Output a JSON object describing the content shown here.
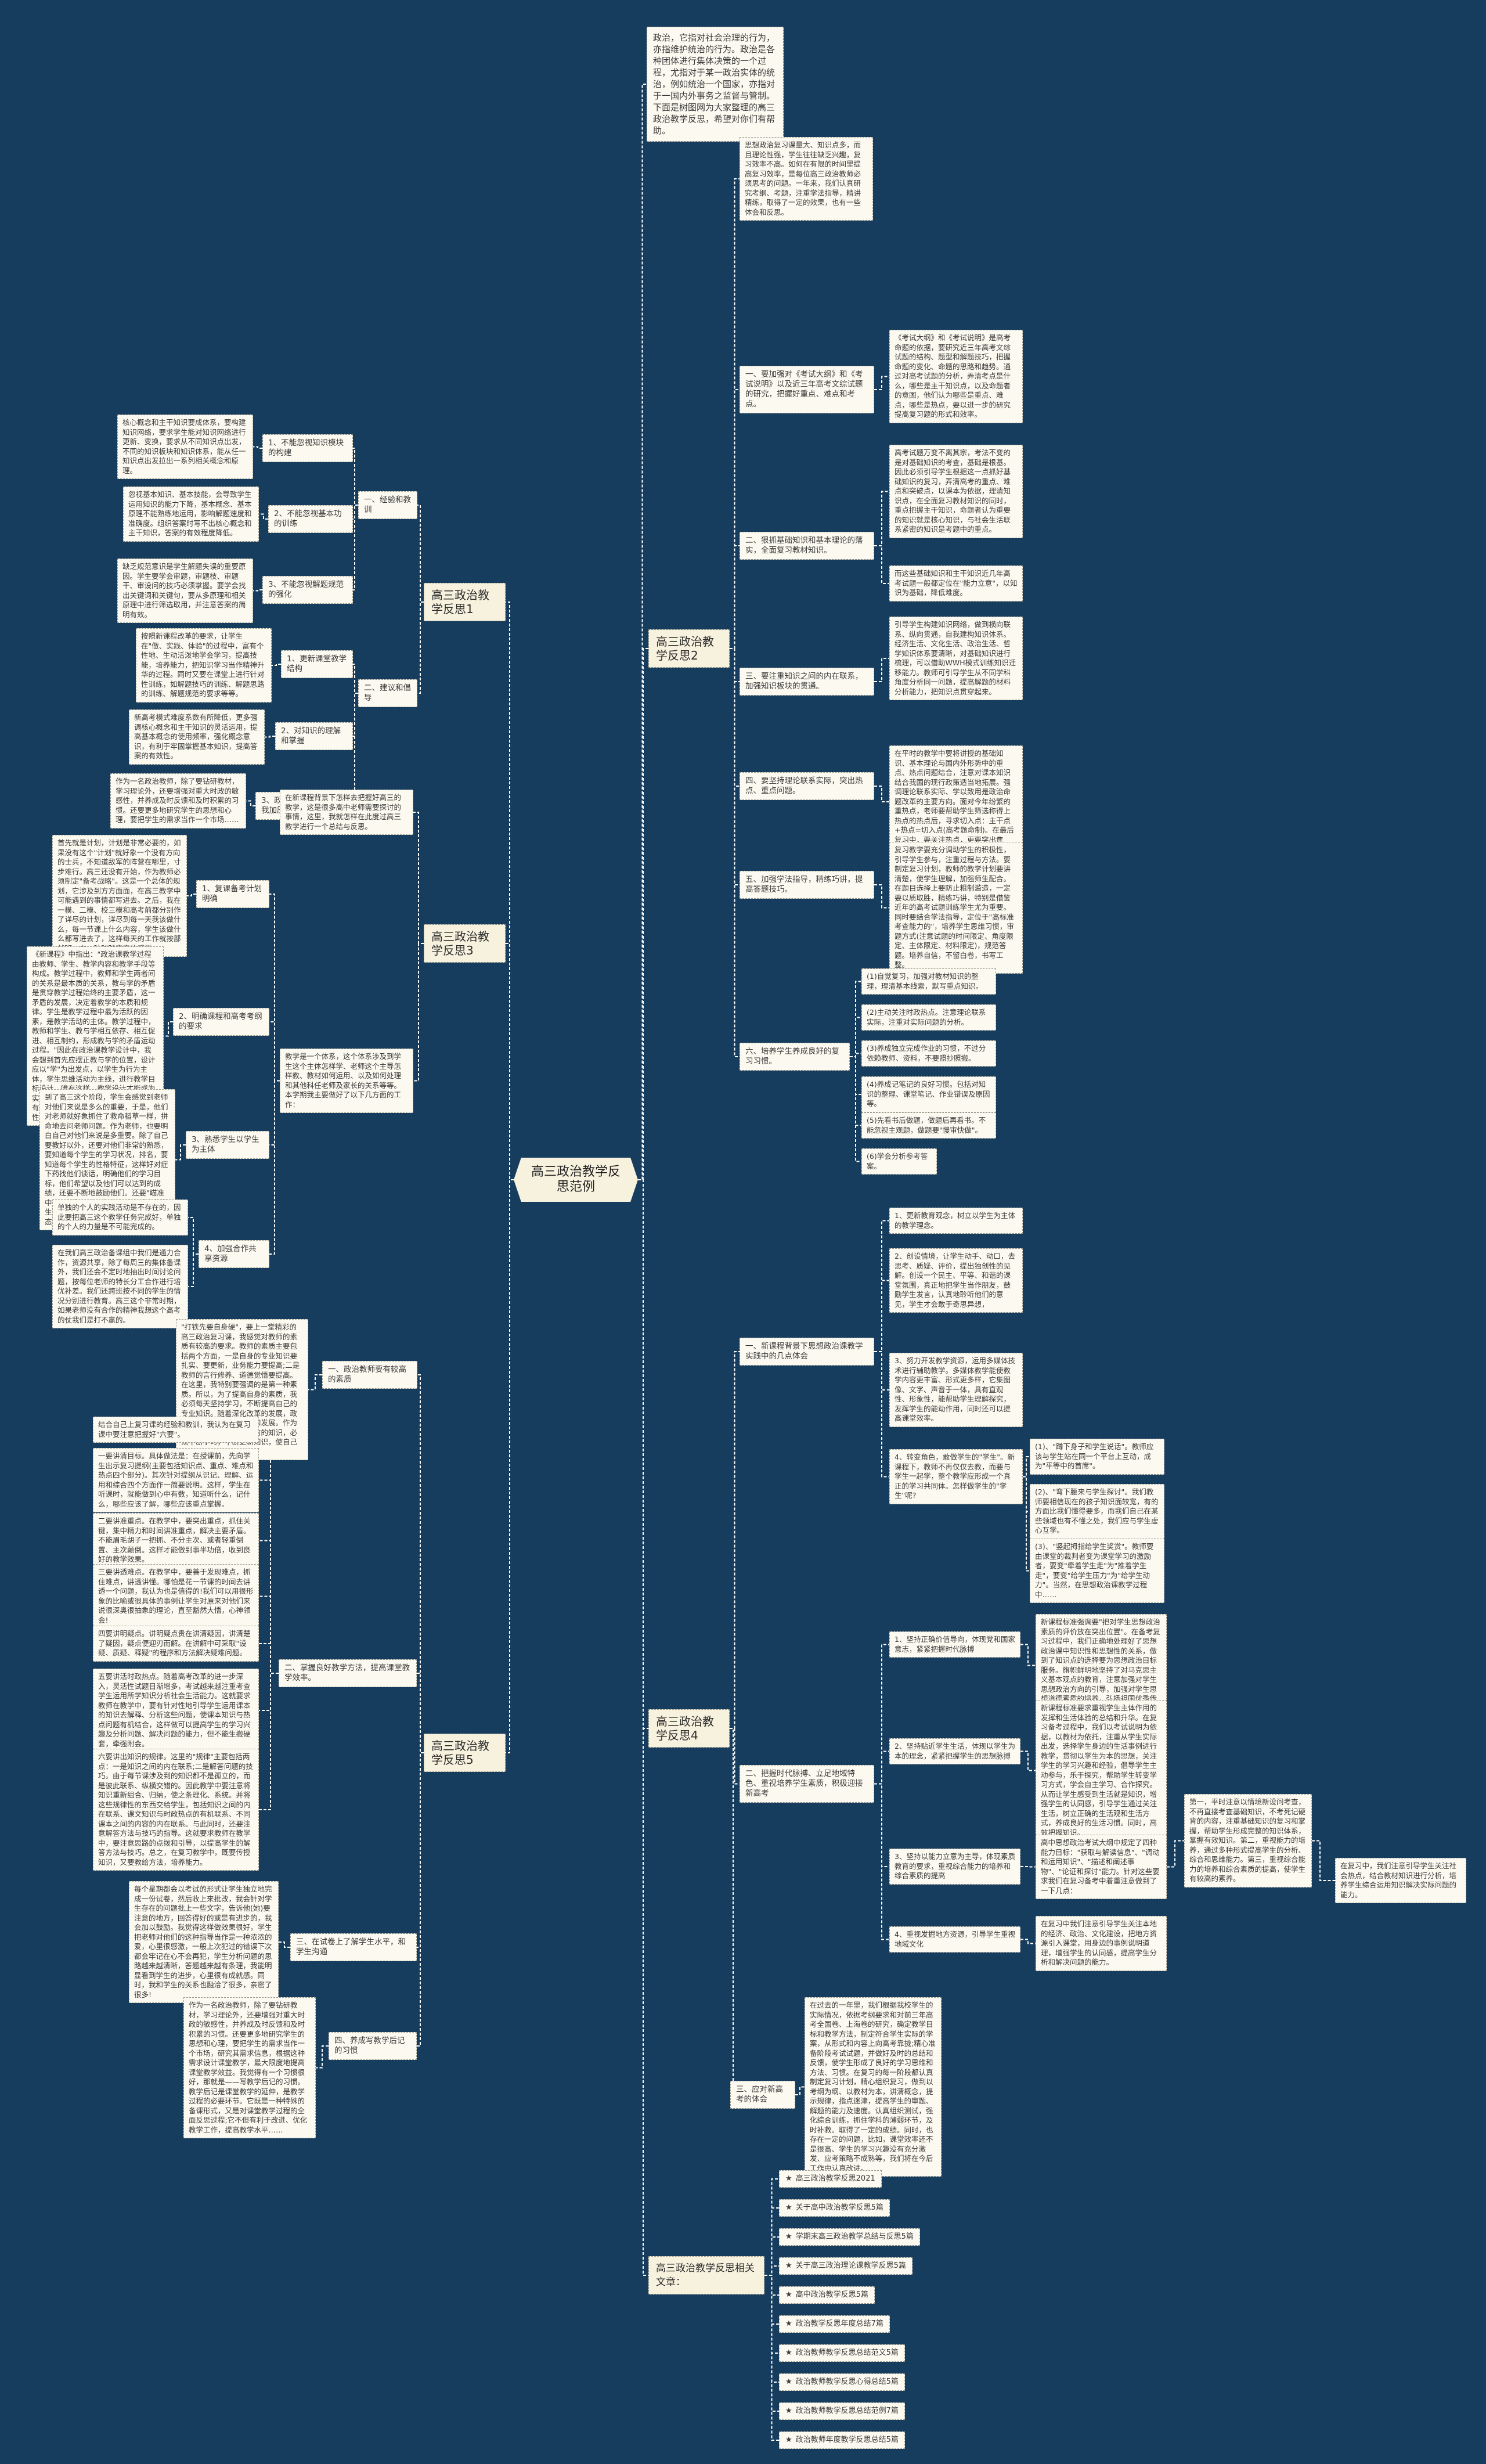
{
  "colors": {
    "background": "#173d5e",
    "node": "#fcfaf0",
    "main_node": "#f7f2de",
    "connector": "#ffffff"
  },
  "root": "高三政治教学反思范例",
  "intro": "政治，它指对社会治理的行为，亦指维护统治的行为。政治是各种团体进行集体决策的一个过程，尤指对于某一政治实体的统治，例如统治一个国家，亦指对于一国内外事务之监督与管制。下面是树图网为大家整理的高三政治教学反思，希望对你们有帮助。",
  "r1": {
    "title": "高三政治教学反思1",
    "a": "一、经验和教训",
    "a1": "1、不能忽视知识模块的构建",
    "a1t": "核心概念和主干知识要成体系，要构建知识网络，要求学生能对知识网络进行更新、变换，要求从不同知识点出发，不同的知识板块和知识体系，能从任一知识点出发拉出一系列相关概念和原理。",
    "a2": "2、不能忽视基本功的训练",
    "a2t": "忽视基本知识、基本技能，会导致学生运用知识的能力下降，基本概念、基本原理不能熟练地运用，影响解题速度和准确度。组织答案时写不出核心概念和主干知识，答案的有效程度降低。",
    "a3": "3、不能忽视解题规范的强化",
    "a3t": "缺乏规范意识是学生解题失误的重要原因。学生要学会审题，审题枝、审题干、审设问的技巧必须掌握。要学会找出关键词和关键句，要从多原理和相关原理中进行筛选取用，并注意答案的简明有效。",
    "b": "二、建议和倡导",
    "b1": "1、更新课堂教学结构",
    "b1t": "按照新课程改革的要求，让学生在\"做、实践、体验\"的过程中，富有个性地、生动活泼地学会学习，提高技能，培养能力，把知识学习当作精神升华的过程。同时又要在课堂上进行针对性训练，如解题技巧的训练、解题思路的训练、解题规范的要求等等。",
    "b2": "2、对知识的理解和掌握",
    "b2t": "新高考模式难度系数有所降低，更多强调核心概念和主干知识的灵活运用，提高基本概念的使用频率，强化概念意识，有利于牢固掌握基本知识，提高答案的有效性。",
    "b3": "3、政治教师要不断地自我加压",
    "b3t": "作为一名政治教师，除了要钻研教材，学习理论外，还要增强对重大时政的敏感性，并养成及时反馈和及时积累的习惯。还要更多地研究学生的思想和心理，要把学生的需求当作一个市场……"
  },
  "r2": {
    "title": "高三政治教学反思2",
    "intro": "思想政治复习课量大、知识点多，而且理论性强，学生往往缺乏兴趣，复习效率不高。如何在有限的时间里提高复习效率，是每位高三政治教师必须思考的问题。一年来，我们认真研究考纲、考题，注重学法指导，精讲精练，取得了一定的效果，也有一些体会和反思。",
    "s1": "一、要加强对《考试大纲》和《考试说明》以及近三年高考文综试题的研究，把握好重点、难点和考点。",
    "s1t": "《考试大纲》和《考试说明》是高考命题的依据，要研究近三年高考文综试题的结构、题型和解题技巧，把握命题的变化、命题的思路和趋势。通过对高考试题的分析，弄清考点是什么，哪些是主干知识点，以及命题者的意图，他们认为哪些是重点、难点，哪些是热点，要以进一步的研究提高复习题的形式和效率。",
    "s2": "二、狠抓基础知识和基本理论的落实，全面复习教材知识。",
    "s2t1": "高考试题万变不离其宗，考法不变的是对基础知识的考查，基础是根基。因此必须引导学生根据这一点抓好基础知识的复习，弄清高考的重点、难点和突破点，以课本为依据，理清知识点，在全面复习教材知识的同时，重点把握主干知识，命题者认为重要的知识就是核心知识，与社会生活联系紧密的知识是考题中的重点。",
    "s2t2": "而这些基础知识和主干知识近几年高考试题一般都定位在\"能力立意\"，以知识为基础，降低难度。",
    "s3": "三、要注重知识之间的内在联系，加强知识板块的贯通。",
    "s3t": "引导学生构建知识网络，做到横向联系、纵向贯通，自我建构知识体系。经济生活、文化生活、政治生活、哲学知识体系要清晰，对基础知识进行梳理，可以借助WWH模式训练知识迁移能力。教师可引导学生从不同学科角度分析同一问题，提高解题的材料分析能力，把知识点贯穿起来。",
    "s4": "四、要坚持理论联系实际，突出热点、重点问题。",
    "s4t": "在平时的教学中要将讲授的基础知识、基本理论与国内外形势中的重点、热点问题结合，注意对课本知识结合我国的现行政策适当地拓展。强调理论联系实际、学以致用是政治命题改革的主要方向。面对今年纷繁的重热点，老师要帮助学生筛选称得上热点的热点后，寻求切入点：主干点+热点=切入点(高考题命制)。在最后复习中，要关注热点，更要突出焦点。",
    "s5": "五、加强学法指导，精练巧讲，提高答题技巧。",
    "s5t": "复习教学要充分调动学生的积极性，引导学生参与，注重过程与方法。要制定复习计划，教师的教学计划要讲清楚，使学生理解，加强师生配合。在题目选择上要防止粗制滥造，一定要以质取胜，精练巧讲，特别是借鉴近年的高考试题训练学生尤为重要。同时要结合学法指导，定位于\"高标准考查能力的\"，培养学生思维习惯，审题方式(注意试题的时间限定、角度限定、主体限定、材料限定)，规范答题。培养自信，不留白卷，书写工整。",
    "s6": "六、培养学生养成良好的复习习惯。",
    "s6_items": [
      "(1)自觉复习，加强对教材知识的整理，理清基本线索，默写重点知识。",
      "(2)主动关注时政热点。注意理论联系实际，注重对实际问题的分析。",
      "(3)养成独立完成作业的习惯，不过分依赖教师、资料，不要照抄照搬。",
      "(4)养成记笔记的良好习惯。包括对知识的整理、课堂笔记、作业错误及原因等。",
      "(5)先看书后做题，做题后再看书。不能忽视主观题，做题要\"慢审快做\"。",
      "(6)学会分析参考答案。"
    ]
  },
  "r3": {
    "title": "高三政治教学反思3",
    "intro": "在新课程背景下怎样去把握好高三的教学，这是很多高中老师需要探讨的事情，这里，我就怎样在此度过高三教学进行一个总结与反思。",
    "system": "教学是一个体系，这个体系涉及到学生这个主体怎样学、老师这个主导怎样教、教材如何运用、以及如何处理和其他科任老师及家长的关系等等。本学期我主要做好了以下几方面的工作：",
    "p1": "1、复课备考计划明确",
    "p1t": "首先就是计划，计划是非常必要的，如果没有这个\"计划\"就好象一个没有方向的士兵，不知道敌军的阵营在哪里，寸步难行。高三还没有开始，作为教师必须制定\"备考战略\"。这是一个总体的规划，它涉及到方方面面，在高三教学中可能遇到的事情都写进去。之后，我在一模、二模、校三模和高考前都分别作了详尽的计划，详尽到每一天我该做什么，每一节课上什么内容，学生该做什么都写进去了，这样每天的工作就按部就班，有一种踏踏实实的感觉。",
    "p2": "2、明确课程和高考考纲的要求",
    "p2t": "《新课程》中指出：\"政治课教学过程由教师、学生、教学内容和教学手段等构成。教学过程中，教师和学生两者间的关系是最本质的关系，教与学的矛盾是贯穿教学过程始终的主要矛盾，这一矛盾的发展，决定着教学的本质和规律。学生是教学过程中最为活跃的因素，是教学活动的主体。教学过程中，教师和学生、教与学相互依存、相互促进、相互制约，形成教与学的矛盾运动过程。\"因此在政治课教学设计中，我会想到首先应摆正教与学的位置，设计应以\"学\"为出发点，以学生为行为主体，学生思维活动为主线，进行教学目标设计。唯有这样，教学设计才能成为实施教学计划的过程的起点。同时，只有研究高考说明，高考复习才有针对性、实效性。",
    "p3": "3、熟悉学生以学生为主体",
    "p3t": "到了高三这个阶段，学生会感觉到老师对他们来说是多么的重要，于是，他们对老师就好象抓住了救命稻草一样，拼命地去问老师问题。作为老师，也要明白自己对他们来说是多重要。除了自己要教好以外，还要对他们非常的熟悉，要知道每个学生的学习状况，排名，要知道每个学生的性格特征，这样好对症下药找他们谈话，明确他们的学习目标，他们希望以及他们可以达到的成绩，还要不断地鼓励他们。还要\"瞄准中间，兼顾两头\"\"每次考试之后这些学生都一一找来谈话了，调节他们的心态。",
    "p4": "4、加强合作共享资源",
    "p4t1": "单独的个人的实践活动是不存在的，因此要把高三这个教学任务完成好，单独的个人的力量是不可能完成的。",
    "p4t2": "在我们高三政治备课组中我们是通力合作，资源共享，除了每周三的集体备课外，我们还会不定时地抽出时间讨论问题，按每位老师的特长分工合作进行培优补差。我们还跨班按不同的学生的情况分别进行教育。高三这个非常时期，如果老师没有合作的精神我想这个高考的仗我们是打不赢的。"
  },
  "r4": {
    "title": "高三政治教学反思4",
    "s1": "一、新课程背景下思想政治课教学实践中的几点体会",
    "s1_1": "1、更新教育观念，树立以学生为主体的教学理念。",
    "s1_2": "2、创设情境，让学生动手、动口，去思考、质疑、评价，提出独创性的见解。创设一个民主、平等、和谐的课堂氛围，真正地把学生当作朋友，鼓励学生发言，认真地聆听他们的意见，学生才会敢于奇思异想，",
    "s1_3": "3、努力开发教学资源，运用多媒体技术进行辅助教学。多媒体教学能使教学内容更丰富、形式更多样，它集图像、文字、声音于一体，具有直观性、形象性，能帮助学生理解探究，发挥学生的能动作用，同时还可以提高课堂效率。",
    "s1_4": "4、转变角色，敢做学生的\"学生\"。新课程下，教师不再仅仅去教，而要与学生一起学，整个教学应形成一个真正的学习共同体。怎样做学生的\"学生\"呢?",
    "s1_4_items": [
      "(1)、\"蹲下身子和学生说话\"。教师应该与学生站在同一个平台上互动，成为\"平等中的首席\"。",
      "(2)、\"弯下腰来与学生探讨\"。我们教师要相信现在的孩子知识面较宽，有的方面比我们懂得要多，而我们自己在某些领域也有不懂之处，我们应与学生虚心互学。",
      "(3)、\"竖起拇指给学生奖赏\"。教师要由课堂的裁判者变为课堂学习的激励者，要变\"牵着学生走\"为\"推着学生走\"，要变\"给学生压力\"为\"给学生动力\"。当然，在思想政治课教学过程中……"
    ],
    "s2": "二、把握时代脉搏、立足地域特色、重视培养学生素质，积极迎接新高考",
    "s2_1": "1、坚持正确价值导向，体现党和国家意志，紧紧把握时代脉搏",
    "s2_1t": "新课程标准强调要\"把对学生思想政治素质的评价放在突出位置\"。在备考复习过程中，我们正确地处理好了思想政治课中知识性和思想性的关系，做到了知识点的选择要为思想政治目标服务。旗帜鲜明地坚持了对马克思主义基本观点的教育，注意加强对学生思想政治方向的引导，加强对学生思想道德素质的培养，弘扬祖国优秀传统文化,培养学生的人文精神。",
    "s2_2": "2、坚持贴近学生生活，体现以学生为本的理念，紧紧把握学生的思想脉搏",
    "s2_2t": "新课程标准要求重视学生主体作用的发挥和生活体验的总结和升华。在复习备考过程中，我们以考试说明为依据，以教材为依托，注重从学生实际出发，选择学生身边的生活事例进行教学，贯彻以学生为本的思想，关注学生的学习兴趣和经验，倡导学生主动参与，乐于探究，帮助学生转变学习方式，学会自主学习、合作探究。从而让学生感受到生活就是知识，增强学生的认同感，引导学生通过关注生活，树立正确的生活观和生活方式，养成良好的生活习惯。同时，高效把握知识。",
    "s2_3": "3、坚持以能力立意为主导，体现素质教育的要求，重视综合能力的培养和综合素质的提高",
    "s2_3t": "高中思想政治考试大纲中规定了四种能力目标：\"获取与解读信息\"、\"调动和运用知识\"、\"描述和阐述事物\"、\"论证和探讨\"能力。针对这些要求我们在复习备考中着重注意做到了一下几点：",
    "s2_3t2": "第一，平时注意以情境新设问考查，不再直接考查基础知识，不考死记硬背的内容，注重基础知识的复习和掌握，帮助学生形成完整的知识体系，掌握有效知识。第二，重视能力的培养，通过多种形式提高学生的分析、综合和思维能力。第三，重视综合能力的培养和综合素质的提高，使学生有较高的素养。",
    "s2_3t3": "在复习中，我们注意引导学生关注社会热点，结合教材知识进行分析，培养学生综合运用知识解决实际问题的能力。",
    "s2_4": "4、重视发掘地方资源，引导学生重视地域文化",
    "s2_4t": "在复习中我们注意引导学生关注本地的经济、政治、文化建设，把地方资源引入课堂，用身边的事例说明道理，增强学生的认同感，提高学生分析和解决问题的能力。",
    "s3": "三、应对新高考的体会",
    "s3t": "在过去的一年里，我们根据我校学生的实际情况，依据考纲要求和对前三年高考全国卷、上海卷的研究，确定教学目标和教学方法，制定符合学生实际的学案，从形式和内容上向高考靠拢;精心准备阶段考试试题，并做好及时的总结和反馈，使学生形成了良好的学习思维和方法、习惯。在复习的每一阶段都认真制定复习计划，精心组织复习，做到以考纲为纲、以教材为本，讲清概念，提示规律，指点迷津，提高学生的审题、解题的能力及速度。认真组织测试，强化综合训练，抓住学科的薄弱环节，及时补救。取得了一定的成绩。同时，也存在一定的问题，比如，课堂效率还不是很高、学生的学习兴趣没有充分激发、应考策略不成熟等，我们将在今后工作中认真改进。"
  },
  "r5": {
    "title": "高三政治教学反思5",
    "s1": "一、政治教师要有较高的素质",
    "s1t": "\"打铁先要自身硬\"，要上一堂精彩的高三政治复习课，我感觉对教师的素质有较高的要求。教师的素质主要包括两个方面，一是自身的专业知识要扎实、要更新，业务能力要提高;二是教师的言行修养、道德觉悟要提高。在这里，我特别要强调的是第一种素质。所以，为了提高自身的素质，我必须每天坚持学习，不断提高自己的专业知识。随着深化改革的发展，政治理论也在不断地丰富和发展。作为政治教师不能满足于原有的知识，必须不断学习，不断更新知识，使自己的认识适应发展的需要。",
    "s2": "二、掌握良好教学方法，提高课堂教学效率。",
    "s2_items": [
      "结合自己上复习课的经验和教训，我认为在复习课中要注意把握好\"六要\"。",
      "一要讲清目标。具体做法是：在授课前，先向学生出示复习提纲(主要包括知识点、重点、难点和热点四个部分)。其次针对提纲从识记、理解、运用和综合四个方面作一简要说明。这样，学生在听课时，就能做到心中有数，知道听什么，记什么，哪些应该了解，哪些应该重点掌握。",
      "二要讲准重点。在教学中，要突出重点，抓住关键，集中精力和时间讲准重点，解决主要矛盾。不能眉毛胡子一把抓、不分主次、或者轻重倒置、主次颠倒。这样才能做到事半功倍，收到良好的教学效果。",
      "三要讲透难点。在教学中，要善于发现难点，抓住难点，讲透讲懂。哪怕是花一节课的时间去讲透一个问题，我认为也是值得的!我们可以用很形象的比喻或很具体的事例让学生对原来对他们来说很深奥很抽象的理论，直至豁然大悟，心神领会!",
      "四要讲明疑点。讲明疑点贵在讲清疑因，讲清楚了疑因，疑点便迎刃而解。在讲解中可采取\"设疑、质疑、释疑\"的程序和方法解决疑难问题。",
      "五要讲活时政热点。随着高考改革的进一步深入，灵活性试题日渐增多，考试越来越注重考查学生运用所学知识分析社会生活能力。这就要求教师在教学中，要有针对性地引导学生运用课本的知识去解释、分析这些问题，使课本知识与热点问题有机结合，这样做可以提高学生的学习兴趣及分析问题、解决问题的能力，但不能生搬硬套，牵强附会。",
      "六要讲出知识的规律。这里的\"规律\"主要包括两点：一是知识之间的内在联系;二是解答问题的技巧。由于每节课涉及到的知识都不是孤立的，而是彼此联系、纵横交错的。因此教学中要注意将知识重新组合、归纳，使之条理化、系统。并将这些规律性的东西交给学生，包括知识之间的内在联系、课文知识与时政热点的有机联系、不同课本之间的内容的内在联系。与此同时，还要注意解答方法与技巧的指导。这就要求教师在教学中，要注意思路的点拨和引导，以提高学生的解答方法与技巧。总之，在复习教学中，既要传授知识，又要教给方法，培养能力。"
    ],
    "s3": "三、在试卷上了解学生水平，和学生沟通",
    "s3t": "每个星期都会以考试的形式让学生独立地完成一份试卷，然后收上来批改，我会针对学生存在的问题批上一些文字，告诉他(她)要注意的地方，回答得好的或是有进步的，我会加以鼓励。我觉得这样做效果很好，学生把老师对他们的这种指导当作是一种浓浓的爱，心里很感激，一般上次犯过的错误下次都会牢记在心不会再犯，学生分析问题的思路越来越清晰，答题越来越有条理，我能明显看到学生的进步，心里很有成就感。同时，我和学生的关系也融洽了很多，亲密了很多!",
    "s4": "四、养成写教学后记的习惯",
    "s4t": "作为一名政治教师，除了要钻研教材，学习理论外，还要增强对重大时政的敏感性，并养成及时反馈和及时积累的习惯。还要更多地研究学生的思想和心理，要把学生的需求当作一个市场，研究其需求信息，根据这种需求设计课堂教学，最大限度地提高课堂教学效益。我觉得有一个习惯很好，那就是——写教学后记的习惯。教学后记是课堂教学的延伸，是教学过程的必要环节。它既是一种特殊的备课形式，又是对课堂教学过程的全面反思过程;它不但有利于改进、优化教学工作，提高教学水平……"
  },
  "related": {
    "title": "高三政治教学反思相关文章：",
    "icon": "star-icon",
    "items": [
      "高三政治教学反思2021",
      "关于高中政治教学反思5篇",
      "学期末高三政治教学总结与反思5篇",
      "关于高三政治理论课教学反思5篇",
      "高中政治教学反思5篇",
      "政治教学反思年度总结7篇",
      "政治教师教学反思总结范文5篇",
      "政治教师教学反思心得总结5篇",
      "政治教师教学反思总结范例7篇",
      "政治教师年度教学反思总结5篇"
    ]
  }
}
